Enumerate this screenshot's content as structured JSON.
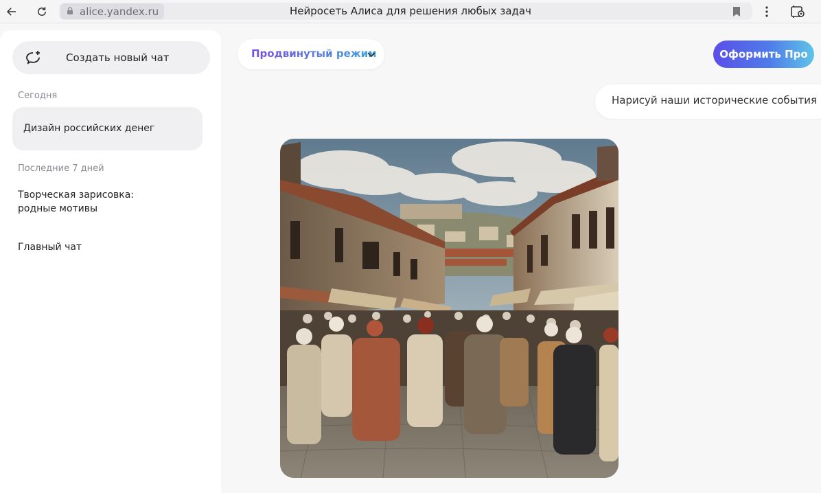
{
  "browser": {
    "url": "alice.yandex.ru",
    "title": "Нейросеть Алиса для решения любых задач",
    "icons": {
      "back": "arrow-left-icon",
      "reload": "reload-icon",
      "lock": "lock-icon",
      "bookmark": "bookmark-icon",
      "menu": "kebab-menu-icon",
      "extension": "screenshot-extension-icon"
    }
  },
  "sidebar": {
    "new_chat_label": "Создать новый чат",
    "sections": [
      {
        "label": "Сегодня",
        "items": [
          {
            "label": "Дизайн российских денег",
            "active": true
          }
        ]
      },
      {
        "label": "Последние 7 дней",
        "items": [
          {
            "label": "Творческая зарисовка: родные мотивы",
            "active": false
          },
          {
            "label": "Главный чат",
            "active": false
          }
        ]
      }
    ]
  },
  "header": {
    "mode_label": "Продвинутый режим",
    "pro_button_label": "Оформить Про"
  },
  "conversation": {
    "user_message": "Нарисуй наши исторические события",
    "image_description_icon": "generated-image"
  },
  "colors": {
    "pro_gradient_start": "#5b4ee8",
    "pro_gradient_end": "#5fc4e8",
    "mode_gradient_start": "#7b4fe0",
    "mode_gradient_end": "#3ea3e0"
  }
}
